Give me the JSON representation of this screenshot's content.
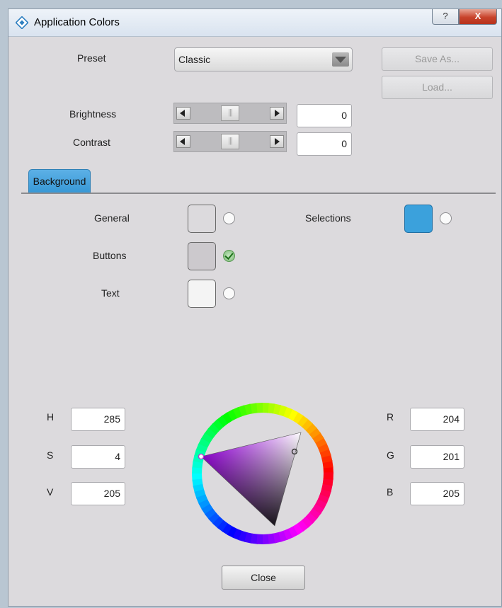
{
  "window": {
    "title": "Application Colors",
    "help_glyph": "?",
    "close_glyph": "X"
  },
  "preset": {
    "label": "Preset",
    "value": "Classic"
  },
  "buttons": {
    "save_as": "Save As...",
    "load": "Load...",
    "close": "Close"
  },
  "brightness": {
    "label": "Brightness",
    "value": "0",
    "thumb": "|||"
  },
  "contrast": {
    "label": "Contrast",
    "value": "0",
    "thumb": "|||"
  },
  "tabs": [
    {
      "label": "Background",
      "active": true
    }
  ],
  "colors": {
    "general": {
      "label": "General",
      "swatch": "#dcdadd",
      "selected": false
    },
    "buttons": {
      "label": "Buttons",
      "swatch": "#ccc9cd",
      "selected": true
    },
    "text": {
      "label": "Text",
      "swatch": "#f4f4f4",
      "selected": false
    },
    "selections": {
      "label": "Selections",
      "swatch": "#3ba1dc",
      "selected": false
    }
  },
  "hsv": {
    "h_label": "H",
    "h": "285",
    "s_label": "S",
    "s": "4",
    "v_label": "V",
    "v": "205"
  },
  "rgb": {
    "r_label": "R",
    "r": "204",
    "g_label": "G",
    "g": "201",
    "b_label": "B",
    "b": "205"
  },
  "accent": "#3898d6",
  "icons": {
    "app": "app-icon",
    "help": "help-icon",
    "close": "close-icon",
    "dropdown": "chevron-down-icon"
  }
}
